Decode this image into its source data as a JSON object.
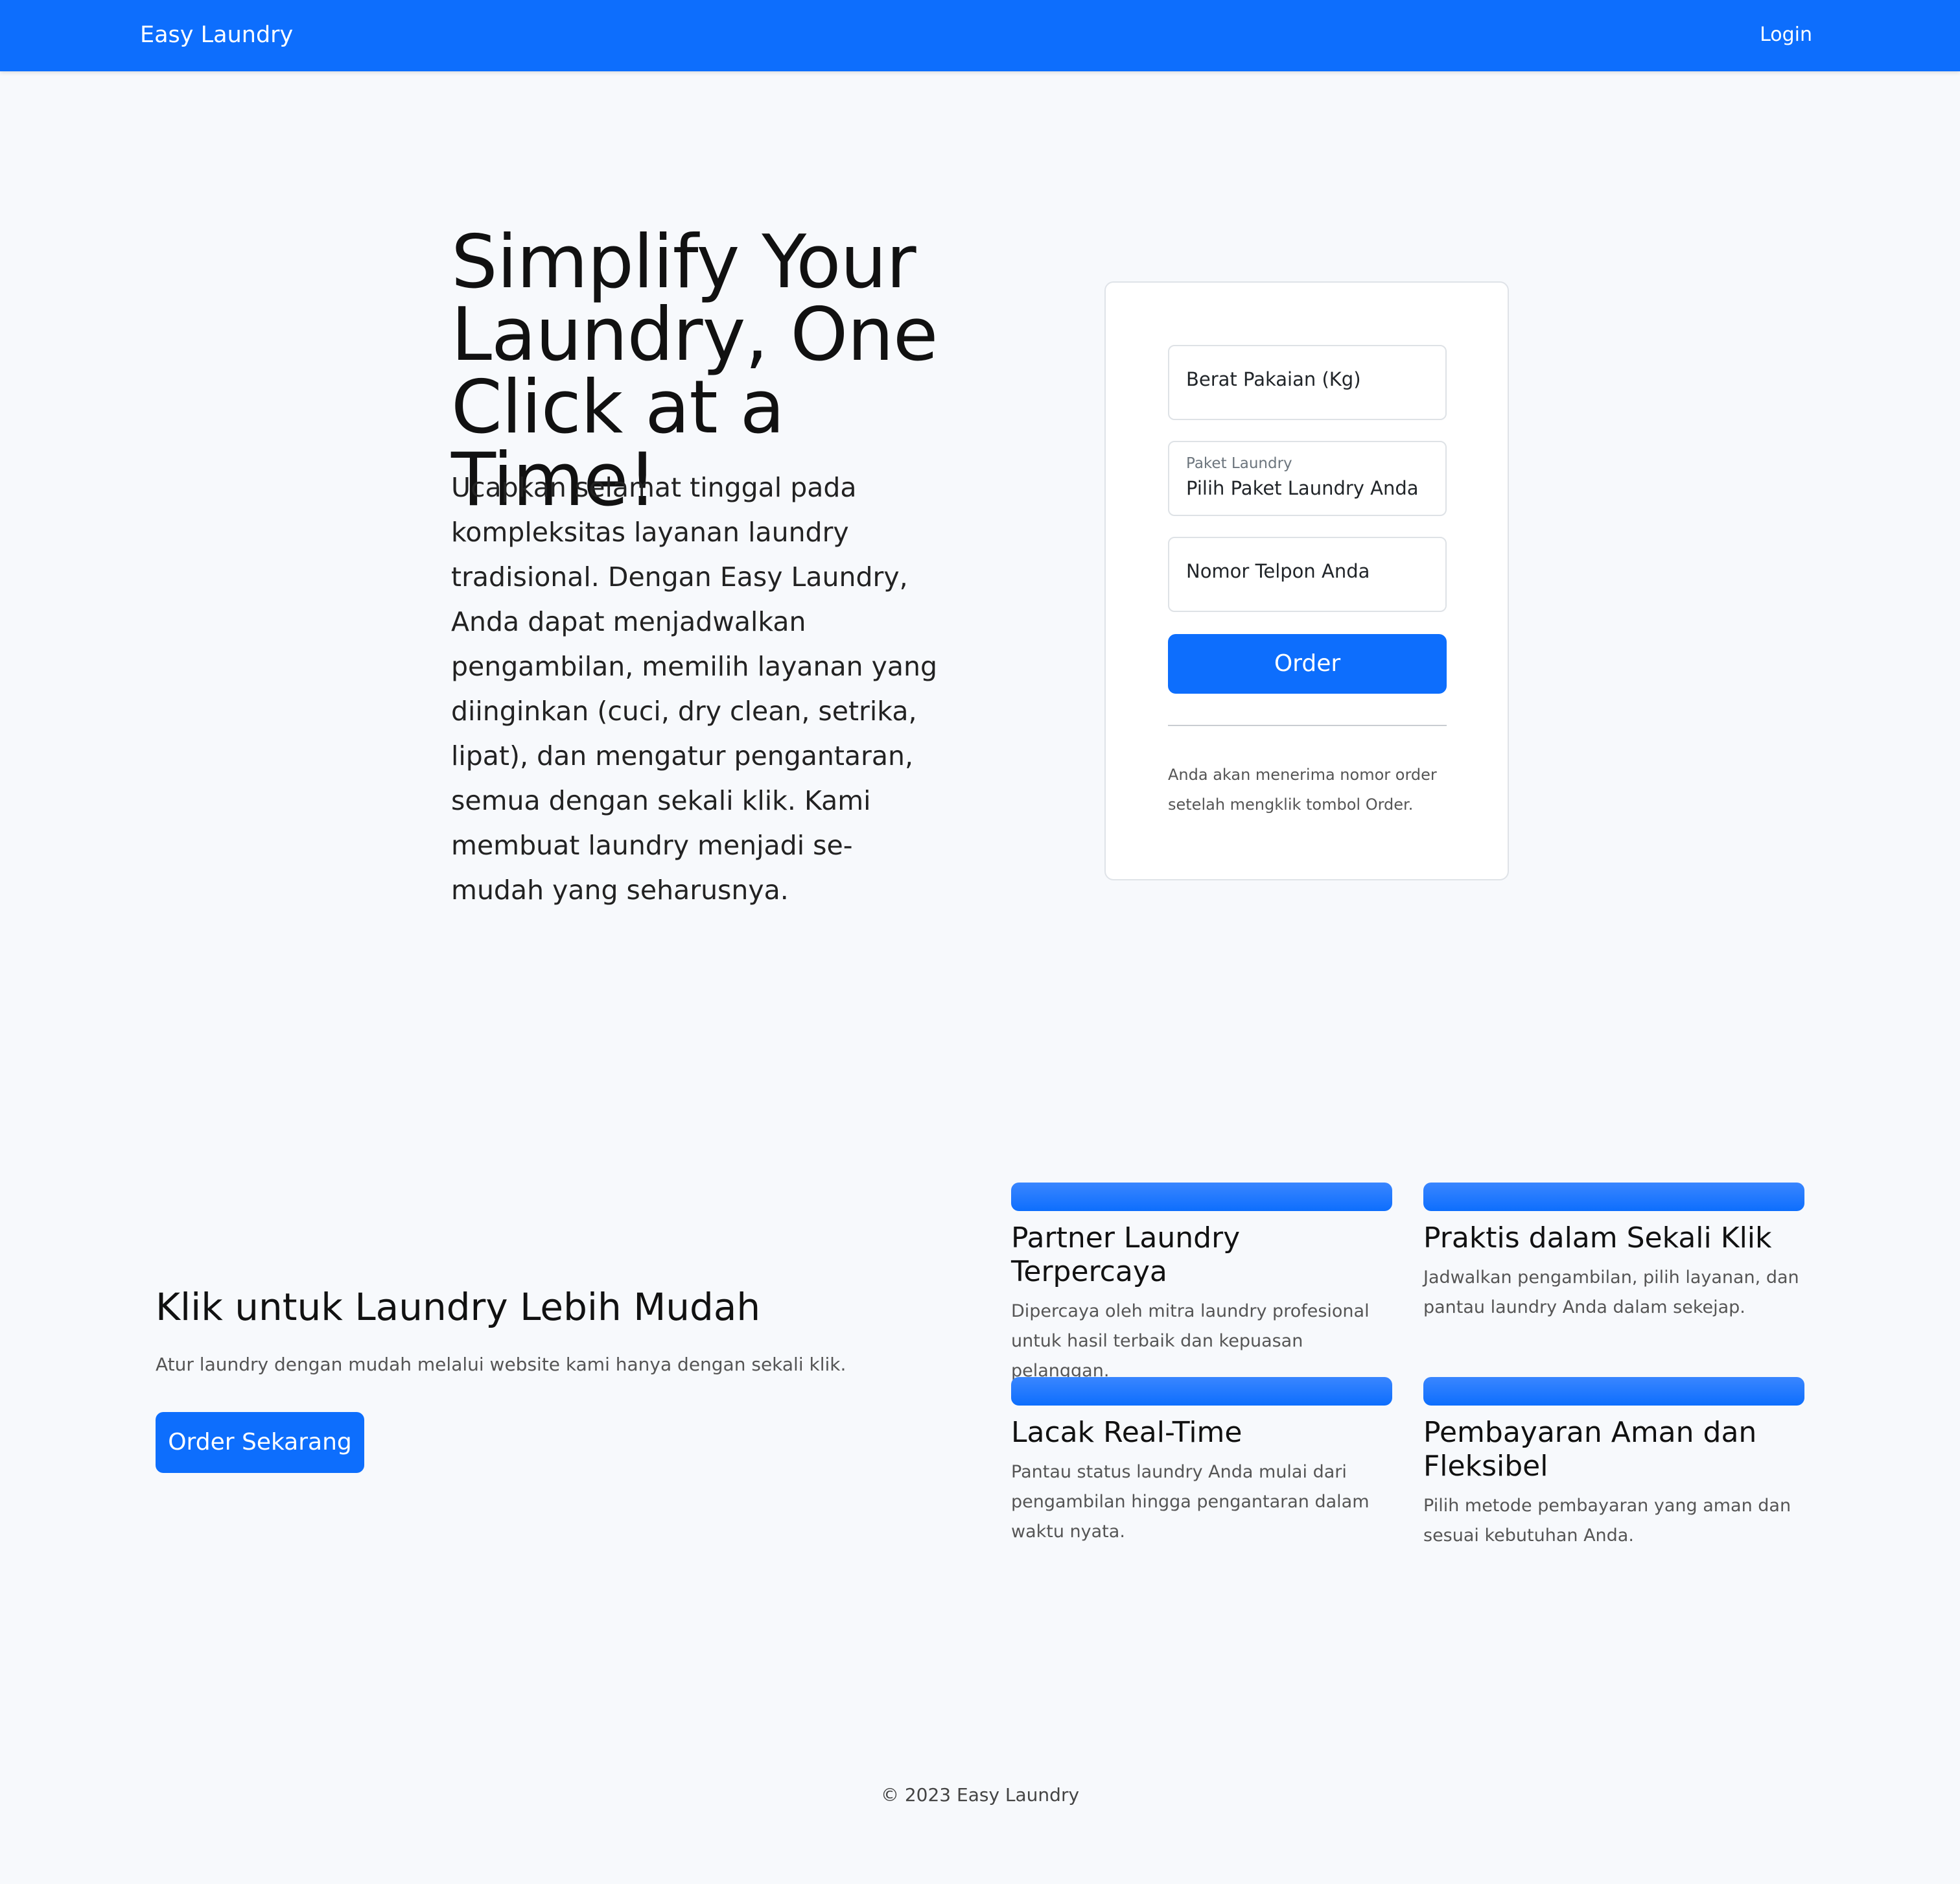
{
  "nav": {
    "brand": "Easy Laundry",
    "login": "Login"
  },
  "hero": {
    "title": "Simplify Your Laundry, One Click at a Time!",
    "description": "Ucapkan selamat tinggal pada kompleksitas layanan laundry tradisional. Dengan Easy Laundry, Anda dapat menjadwalkan pengambilan, memilih layanan yang diinginkan (cuci, dry clean, setrika, lipat), dan mengatur pengantaran, semua dengan sekali klik. Kami membuat laundry menjadi se-mudah yang seharusnya."
  },
  "order_form": {
    "weight_placeholder": "Berat Pakaian (Kg)",
    "package_label": "Paket Laundry",
    "package_selected": "Pilih Paket Laundry Anda",
    "phone_placeholder": "Nomor Telpon Anda",
    "submit_label": "Order",
    "note": "Anda akan menerima nomor order setelah mengklik tombol Order."
  },
  "cta": {
    "title": "Klik untuk Laundry Lebih Mudah",
    "text": "Atur laundry dengan mudah melalui website kami hanya dengan sekali klik.",
    "button": "Order Sekarang"
  },
  "features": [
    {
      "title": "Partner Laundry Terpercaya",
      "text": "Dipercaya oleh mitra laundry profesional untuk hasil terbaik dan kepuasan pelanggan."
    },
    {
      "title": "Praktis dalam Sekali Klik",
      "text": "Jadwalkan pengambilan, pilih layanan, dan pantau laundry Anda dalam sekejap."
    },
    {
      "title": "Lacak Real-Time",
      "text": "Pantau status laundry Anda mulai dari pengambilan hingga pengantaran dalam waktu nyata."
    },
    {
      "title": "Pembayaran Aman dan Fleksibel",
      "text": "Pilih metode pembayaran yang aman dan sesuai kebutuhan Anda."
    }
  ],
  "footer": {
    "copyright": "© 2023 Easy Laundry"
  },
  "colors": {
    "primary": "#0d6efd",
    "background": "#f7f9fc"
  }
}
